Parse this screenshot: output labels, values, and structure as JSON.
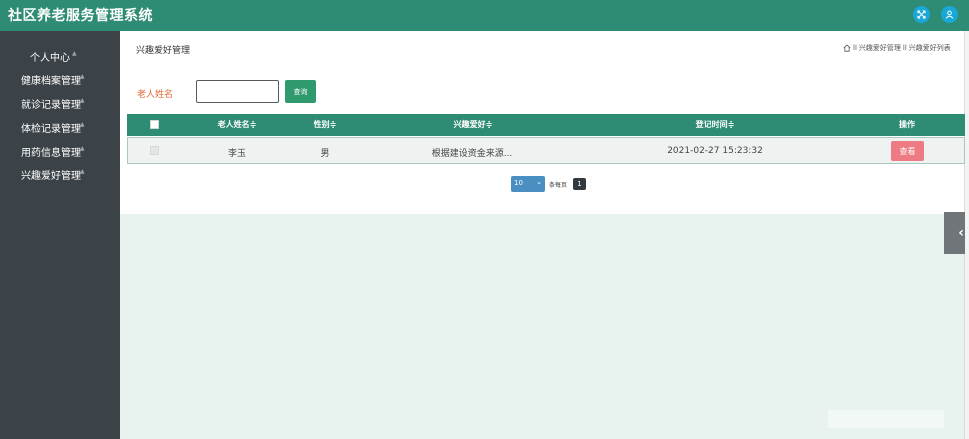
{
  "header": {
    "title": "社区养老服务管理系统",
    "icons": [
      "expand-icon",
      "user-icon"
    ],
    "color": "#2e8b74"
  },
  "sidebar": {
    "items": [
      {
        "label": "个人中心"
      },
      {
        "label": "健康档案管理"
      },
      {
        "label": "就诊记录管理"
      },
      {
        "label": "体检记录管理"
      },
      {
        "label": "用药信息管理"
      },
      {
        "label": "兴趣爱好管理"
      }
    ]
  },
  "page": {
    "title": "兴趣爱好管理",
    "breadcrumb": [
      "兴趣爱好管理",
      "兴趣爱好列表"
    ],
    "breadcrumb_sep": "ll"
  },
  "search": {
    "label": "老人姓名",
    "value": "",
    "button_label": "查询"
  },
  "table": {
    "columns": [
      "老人姓名≑",
      "性别≑",
      "兴趣爱好≑",
      "登记时间≑",
      "操作"
    ],
    "rows": [
      {
        "name": "李玉",
        "gender": "男",
        "hobby": "根据建设资金来源...",
        "time": "2021-02-27 15:23:32",
        "action": "查看"
      }
    ]
  },
  "pagination": {
    "page_size": "10",
    "per_page_label": "条每页",
    "current_page": "1"
  }
}
